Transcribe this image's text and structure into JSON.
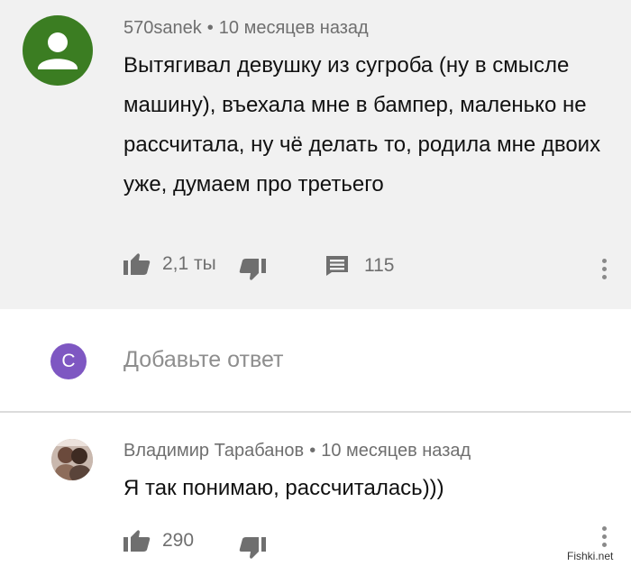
{
  "comment": {
    "author": "570sanek",
    "separator": "•",
    "time": "10 месяцев назад",
    "text": "Вытягивал девушку из сугроба (ну в смысле машину), въехала мне в бампер, маленько не рассчитала, ну чё делать то, родила мне двоих уже, думаем про третьего",
    "likes": "2,1 ты",
    "replies_count": "115",
    "avatar_color": "#3b7d22",
    "icons": [
      "thumb-up-icon",
      "thumb-down-icon",
      "reply-comment-icon",
      "more-vertical-icon"
    ]
  },
  "reply_box": {
    "avatar_letter": "С",
    "avatar_color": "#7e57c2",
    "placeholder": "Добавьте ответ"
  },
  "reply": {
    "author": "Владимир Тарабанов",
    "separator": "•",
    "time": "10 месяцев назад",
    "text": "Я так понимаю, рассчиталась)))",
    "likes": "290",
    "icons": [
      "thumb-up-icon",
      "thumb-down-icon",
      "more-vertical-icon"
    ]
  },
  "watermark": "Fishki.net"
}
